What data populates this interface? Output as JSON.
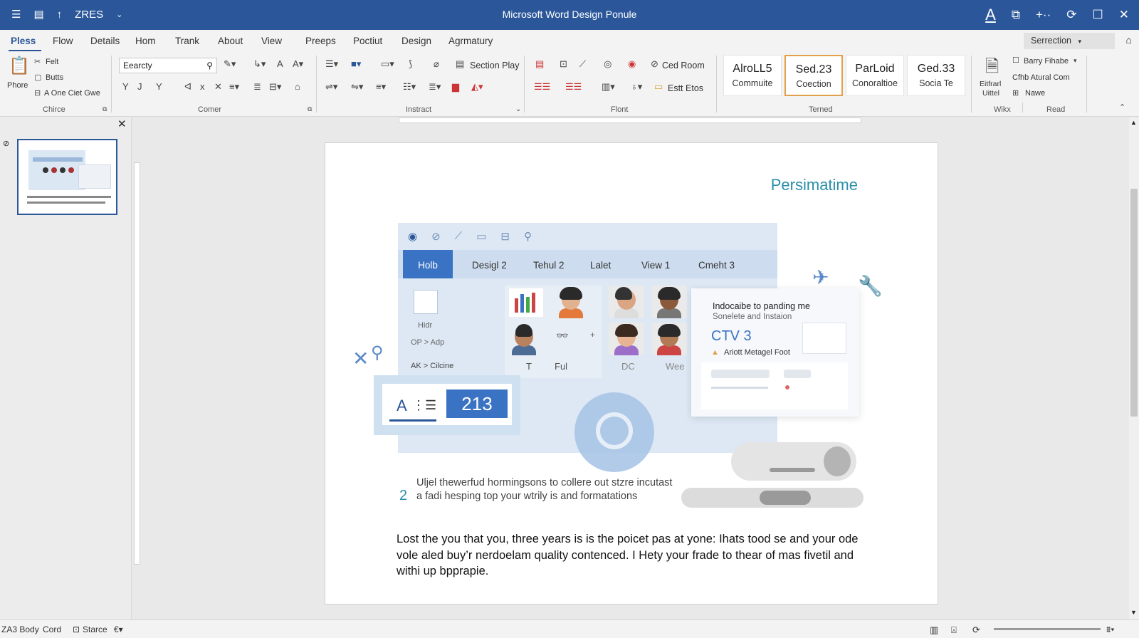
{
  "window": {
    "title": "Microsoft Word Design Ponule"
  },
  "quick_access": {
    "label": "ZRES"
  },
  "tabs": [
    "Pless",
    "Flow",
    "Details",
    "Hom",
    "Trank",
    "About",
    "View",
    "Preeps",
    "Poctiut",
    "Design",
    "Agrmatury"
  ],
  "search": {
    "label": "Serrection"
  },
  "ribbon": {
    "chirce": {
      "phore": "Phore",
      "felt": "Felt",
      "butts": "Butts",
      "one_ciet": "A One Ciet Gwe",
      "label": "Chirce"
    },
    "comer": {
      "font_name": "Eearcty",
      "label": "Comer"
    },
    "instract": {
      "section_play": "Section Play",
      "label": "Instract"
    },
    "flont": {
      "led_room": "Ced Room",
      "estt_ltos": "Estt Etos",
      "label": "Flont"
    },
    "styles": [
      {
        "name": "AlroLL5",
        "sub": "Commuite"
      },
      {
        "name": "Sed.23",
        "sub": "Coection"
      },
      {
        "name": "ParLoid",
        "sub": "Conoraltioe"
      },
      {
        "name": "Ged.33",
        "sub": "Socia Te"
      }
    ],
    "terned_label": "Terned",
    "right": {
      "eitfrarl": "Eitfrarl",
      "uitter": "Uittel",
      "barry": "Barry Fihabe",
      "cfhb": "Cfhb Atural Com",
      "nawe": "Nawe",
      "wikx": "Wikx",
      "read": "Read"
    }
  },
  "document": {
    "heading": "Persimatime",
    "mock_tabs": [
      "Holb",
      "Desigl 2",
      "Tehul 2",
      "Lalet",
      "View 1",
      "Cmeht 3"
    ],
    "mock_labels": {
      "hidr": "Hidr",
      "op_adp": "OP > Adp",
      "ak_cilcine": "AK > Cilcine",
      "ful": "Ful",
      "dc": "DC",
      "wee": "Wee",
      "t": "T"
    },
    "card": {
      "title": "Indocaibe to panding me",
      "subtitle": "Sonelete and Instaion",
      "ctv": "CTV 3",
      "warning": "Ariott Metagel Foot"
    },
    "numbox": {
      "a": "A",
      "num": "213"
    },
    "list_number": "2",
    "list_text": "Uljel thewerfud hormingsons to collere out stzre incutast a fadi hesping top your wtrily is and formatations",
    "body_text": "Lost the you that you, three years is is the poicet pas at yone: Ihats tood se and your ode vole aled buy’r nerdoelam quality contenced. I Hety your frade to thear of mas fivetil and withi up bpprapie."
  },
  "statusbar": {
    "body": "ZA3 Body",
    "cord": "Cord",
    "starce": "Starce"
  },
  "colors": {
    "titlebar": "#2b579a",
    "accent": "#3a73c4",
    "heading": "#2a8fa8",
    "selected_style_border": "#e3a04a"
  }
}
